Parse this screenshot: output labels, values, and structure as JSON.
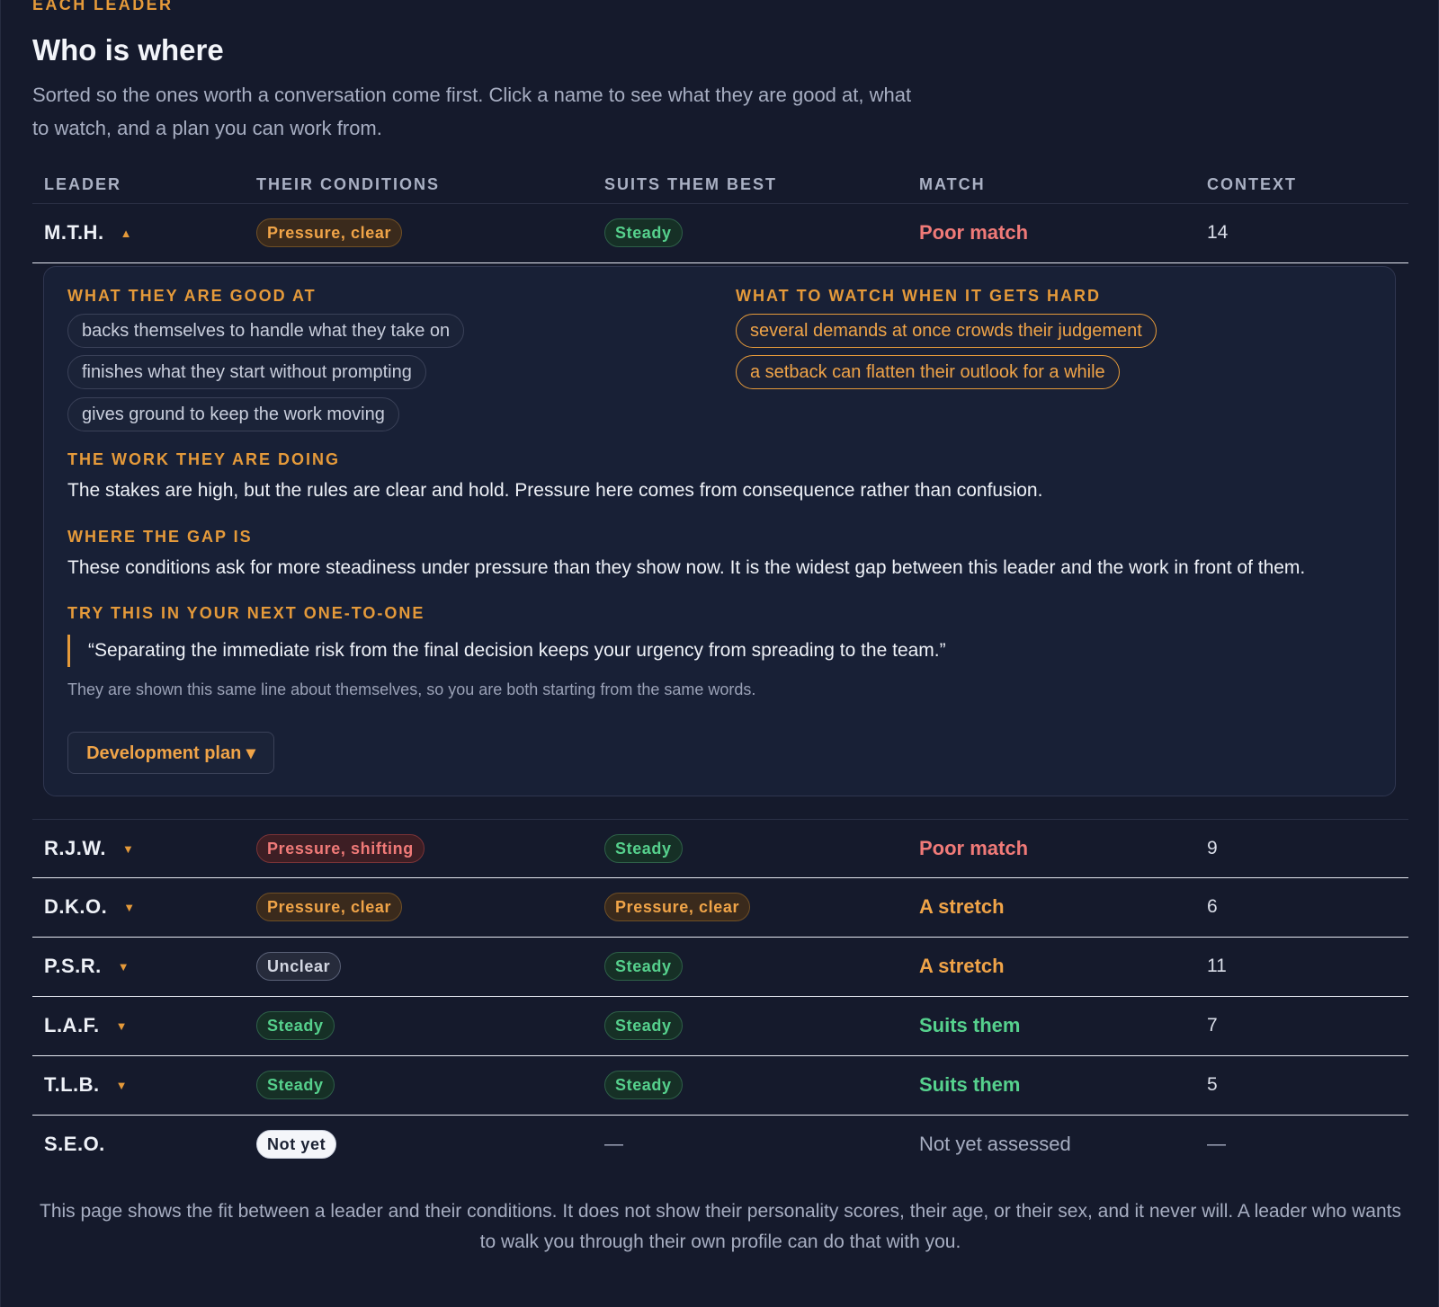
{
  "section": {
    "eyebrow": "EACH LEADER",
    "title": "Who is where",
    "lede": "Sorted so the ones worth a conversation come first. Click a name to see what they are good at, what to watch, and a plan you can work from."
  },
  "table": {
    "headers": [
      "LEADER",
      "THEIR CONDITIONS",
      "SUITS THEM BEST",
      "MATCH",
      "CONTEXT"
    ],
    "rows": [
      {
        "leader": "M.T.H.",
        "caret": "▲",
        "conditions": "Pressure, clear",
        "suits": "Steady",
        "match": "Poor match",
        "context": "14"
      },
      {
        "leader": "R.J.W.",
        "caret": "▼",
        "conditions": "Pressure, shifting",
        "suits": "Steady",
        "match": "Poor match",
        "context": "9"
      },
      {
        "leader": "D.K.O.",
        "caret": "▼",
        "conditions": "Pressure, clear",
        "suits": "Pressure, clear",
        "match": "A stretch",
        "context": "6"
      },
      {
        "leader": "P.S.R.",
        "caret": "▼",
        "conditions": "Unclear",
        "suits": "Steady",
        "match": "A stretch",
        "context": "11"
      },
      {
        "leader": "L.A.F.",
        "caret": "▼",
        "conditions": "Steady",
        "suits": "Steady",
        "match": "Suits them",
        "context": "7"
      },
      {
        "leader": "T.L.B.",
        "caret": "▼",
        "conditions": "Steady",
        "suits": "Steady",
        "match": "Suits them",
        "context": "5"
      },
      {
        "leader": "S.E.O.",
        "caret": "",
        "conditions": "Not yet",
        "suits": "—",
        "match": "Not yet assessed",
        "context": "—"
      }
    ]
  },
  "detail": {
    "good_at_label": "WHAT THEY ARE GOOD AT",
    "good_at": [
      "backs themselves to handle what they take on",
      "finishes what they start without prompting",
      "gives ground to keep the work moving"
    ],
    "watch_label": "WHAT TO WATCH WHEN IT GETS HARD",
    "watch": [
      "several demands at once crowds their judgement",
      "a setback can flatten their outlook for a while"
    ],
    "work_label": "THE WORK THEY ARE DOING",
    "work_text": "The stakes are high, but the rules are clear and hold. Pressure here comes from consequence rather than confusion.",
    "gap_label": "WHERE THE GAP IS",
    "gap_text": "These conditions ask for more steadiness under pressure than they show now. It is the widest gap between this leader and the work in front of them.",
    "try_label": "TRY THIS IN YOUR NEXT ONE-TO-ONE",
    "quote": "“Separating the immediate risk from the final decision keeps your urgency from spreading to the team.”",
    "note": "They are shown this same line about themselves, so you are both starting from the same words.",
    "plan_button": "Development plan ▾"
  },
  "footer": "This page shows the fit between a leader and their conditions. It does not show their personality scores, their age, or their sex, and it never will. A leader who wants to walk you through their own profile can do that with you.",
  "colors": {
    "background": "#151a2c",
    "accent": "#e59a3a",
    "poor": "#f07a78",
    "good": "#56d18d"
  }
}
